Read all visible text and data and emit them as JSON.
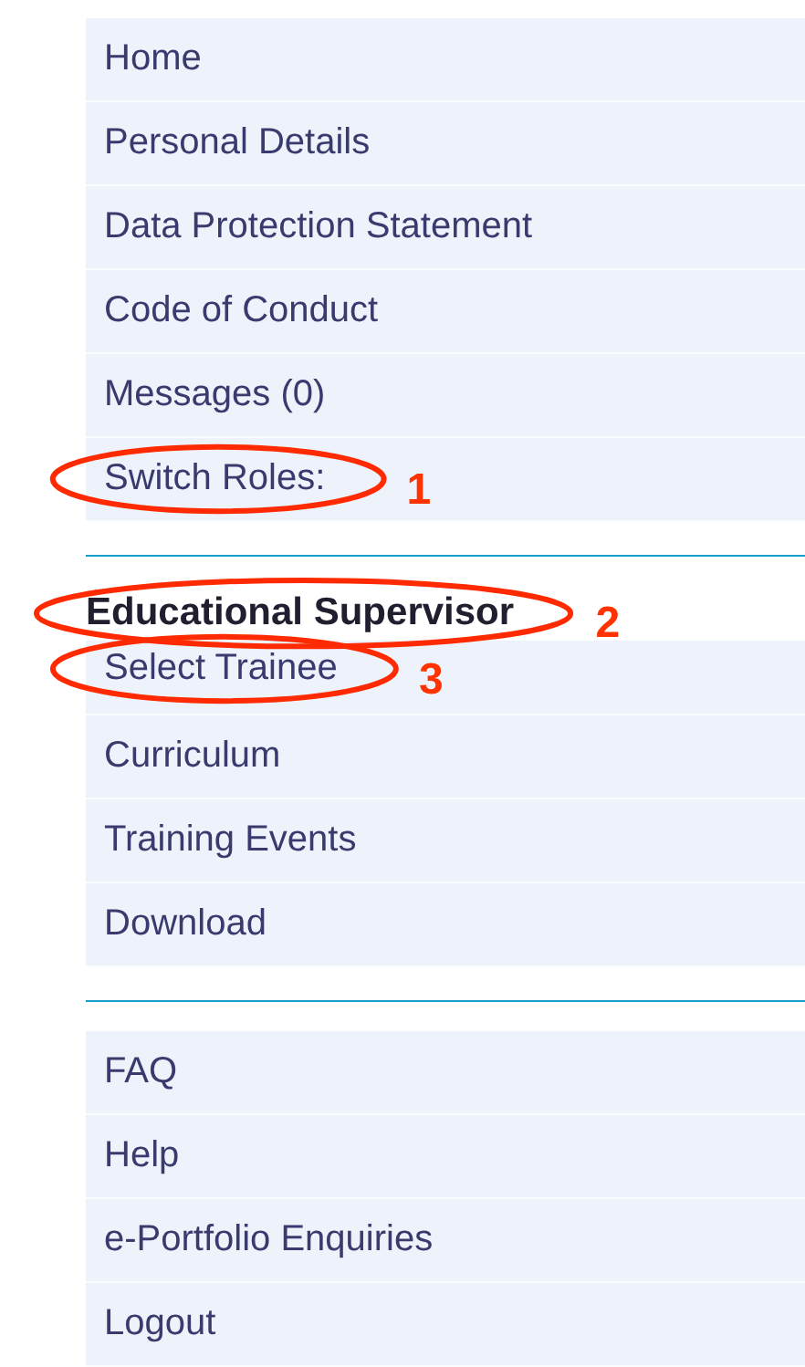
{
  "sections": [
    {
      "items": [
        {
          "label": "Home"
        },
        {
          "label": "Personal Details"
        },
        {
          "label": "Data Protection Statement"
        },
        {
          "label": "Code of Conduct"
        },
        {
          "label": "Messages (0)"
        },
        {
          "label": "Switch Roles:",
          "annotation": {
            "number": "1"
          }
        }
      ]
    },
    {
      "heading": {
        "label": "Educational Supervisor",
        "annotation": {
          "number": "2"
        }
      },
      "items": [
        {
          "label": "Select Trainee",
          "annotation": {
            "number": "3"
          }
        },
        {
          "label": "Curriculum"
        },
        {
          "label": "Training Events"
        },
        {
          "label": "Download"
        }
      ]
    },
    {
      "items": [
        {
          "label": "FAQ"
        },
        {
          "label": "Help"
        },
        {
          "label": "e-Portfolio Enquiries"
        },
        {
          "label": "Logout"
        }
      ]
    }
  ]
}
